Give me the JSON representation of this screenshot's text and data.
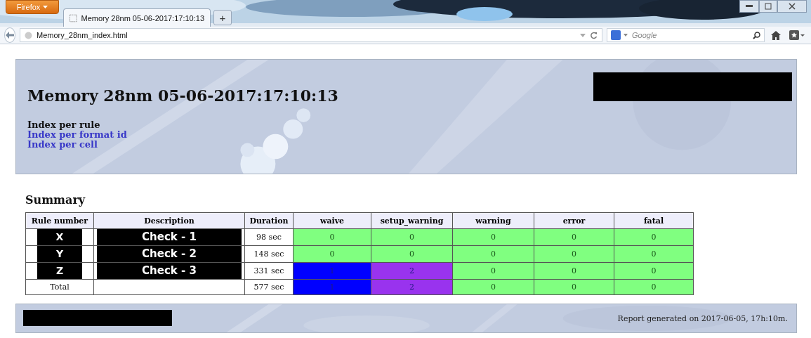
{
  "browser": {
    "menu_button": "Firefox",
    "tab": {
      "title": "Memory 28nm 05-06-2017:17:10:13",
      "selected": true
    },
    "new_tab": "+",
    "address": "Memory_28nm_index.html",
    "search": {
      "placeholder": "Google"
    }
  },
  "header": {
    "title": "Memory 28nm 05-06-2017:17:10:13",
    "links": [
      {
        "label": "Index per rule",
        "selected": true
      },
      {
        "label": "Index per format id",
        "selected": false
      },
      {
        "label": "Index per cell",
        "selected": false
      }
    ]
  },
  "summary": {
    "heading": "Summary",
    "columns": [
      "Rule number",
      "Description",
      "Duration",
      "waive",
      "setup_warning",
      "warning",
      "error",
      "fatal"
    ],
    "rows": [
      {
        "rule": "X",
        "description": "Check - 1",
        "duration": "98 sec",
        "redacted": true,
        "counts": [
          {
            "text": "0",
            "color": "#80ff80"
          },
          {
            "text": "0",
            "color": "#80ff80"
          },
          {
            "text": "0",
            "color": "#80ff80"
          },
          {
            "text": "0",
            "color": "#80ff80"
          },
          {
            "text": "0",
            "color": "#80ff80"
          }
        ]
      },
      {
        "rule": "Y",
        "description": "Check - 2",
        "duration": "148 sec",
        "redacted": true,
        "counts": [
          {
            "text": "0",
            "color": "#80ff80"
          },
          {
            "text": "0",
            "color": "#80ff80"
          },
          {
            "text": "0",
            "color": "#80ff80"
          },
          {
            "text": "0",
            "color": "#80ff80"
          },
          {
            "text": "0",
            "color": "#80ff80"
          }
        ]
      },
      {
        "rule": "Z",
        "description": "Check - 3",
        "duration": "331 sec",
        "redacted": true,
        "counts": [
          {
            "text": "1",
            "color": "#0000ff"
          },
          {
            "text": "2",
            "color": "#9933ee"
          },
          {
            "text": "0",
            "color": "#80ff80"
          },
          {
            "text": "0",
            "color": "#80ff80"
          },
          {
            "text": "0",
            "color": "#80ff80"
          }
        ]
      },
      {
        "rule": "Total",
        "duration": "577 sec",
        "redacted": false,
        "counts": [
          {
            "text": "1",
            "color": "#0000ff"
          },
          {
            "text": "2",
            "color": "#9933ee"
          },
          {
            "text": "0",
            "color": "#80ff80"
          },
          {
            "text": "0",
            "color": "#80ff80"
          },
          {
            "text": "0",
            "color": "#80ff80"
          }
        ]
      }
    ]
  },
  "footer": {
    "text": "Report generated on 2017-06-05, 17h:10m."
  }
}
